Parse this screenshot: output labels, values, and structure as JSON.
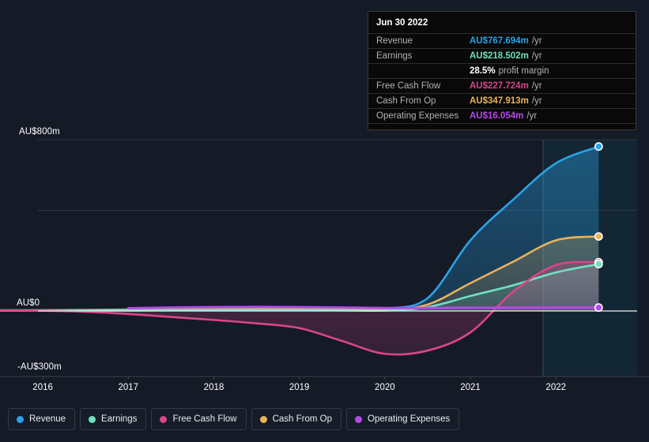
{
  "chart_data": {
    "type": "area",
    "title": "",
    "xlabel": "",
    "ylabel": "",
    "currency": "AU$",
    "grid": true,
    "legend_position": "bottom",
    "x": [
      2015.5,
      2016,
      2016.5,
      2017,
      2017.5,
      2018,
      2018.5,
      2019,
      2019.5,
      2020,
      2020.5,
      2021,
      2021.5,
      2022,
      2022.5
    ],
    "xlim": [
      2015.5,
      2022.95
    ],
    "ylim": [
      -300,
      800
    ],
    "y_ticks": [
      {
        "label": "AU$800m",
        "value": 800
      },
      {
        "label": "AU$0",
        "value": 0
      },
      {
        "label": "-AU$300m",
        "value": -300
      }
    ],
    "x_ticks": [
      "2016",
      "2017",
      "2018",
      "2019",
      "2020",
      "2021",
      "2022"
    ],
    "forecast_start": 2021.85,
    "series": [
      {
        "name": "Revenue",
        "color": "#2aa3e8",
        "values": [
          3,
          4,
          5,
          7,
          9,
          11,
          13,
          14,
          13,
          12,
          60,
          330,
          520,
          690,
          768
        ]
      },
      {
        "name": "Earnings",
        "color": "#6fe0c0",
        "values": [
          1,
          1,
          2,
          2,
          3,
          3,
          4,
          4,
          3,
          2,
          18,
          70,
          120,
          180,
          219
        ]
      },
      {
        "name": "Free Cash Flow",
        "color": "#d9468a",
        "values": [
          2,
          1,
          -4,
          -14,
          -28,
          -42,
          -58,
          -80,
          -140,
          -200,
          -185,
          -100,
          90,
          215,
          228
        ]
      },
      {
        "name": "Cash From Op",
        "color": "#e8b35c",
        "values": [
          3,
          3,
          4,
          5,
          6,
          7,
          8,
          8,
          7,
          6,
          30,
          130,
          230,
          330,
          348
        ]
      },
      {
        "name": "Operating Expenses",
        "color": "#b44ae8",
        "values": [
          null,
          null,
          null,
          13,
          16,
          18,
          19,
          18,
          16,
          14,
          14,
          15,
          15,
          16,
          16
        ]
      }
    ]
  },
  "tooltip": {
    "date": "Jun 30 2022",
    "suffix": "/yr",
    "rows": [
      {
        "key": "Revenue",
        "value": "AU$767.694m",
        "suffix": "/yr",
        "color": "#2aa3e8"
      },
      {
        "key": "Earnings",
        "value": "AU$218.502m",
        "suffix": "/yr",
        "color": "#6fe0c0"
      },
      {
        "key": "",
        "value": "28.5%",
        "suffix": "profit margin",
        "color": "#ffffff"
      },
      {
        "key": "Free Cash Flow",
        "value": "AU$227.724m",
        "suffix": "/yr",
        "color": "#d9468a"
      },
      {
        "key": "Cash From Op",
        "value": "AU$347.913m",
        "suffix": "/yr",
        "color": "#e8b35c"
      },
      {
        "key": "Operating Expenses",
        "value": "AU$16.054m",
        "suffix": "/yr",
        "color": "#b44ae8"
      }
    ]
  },
  "legend": {
    "items": [
      {
        "label": "Revenue",
        "color": "#2aa3e8"
      },
      {
        "label": "Earnings",
        "color": "#6fe0c0"
      },
      {
        "label": "Free Cash Flow",
        "color": "#d9468a"
      },
      {
        "label": "Cash From Op",
        "color": "#e8b35c"
      },
      {
        "label": "Operating Expenses",
        "color": "#b44ae8"
      }
    ]
  },
  "colors": {
    "background": "#141a26",
    "grid": "#2e3746",
    "axis_text": "#ffffff",
    "forecast_band": "#123040"
  }
}
